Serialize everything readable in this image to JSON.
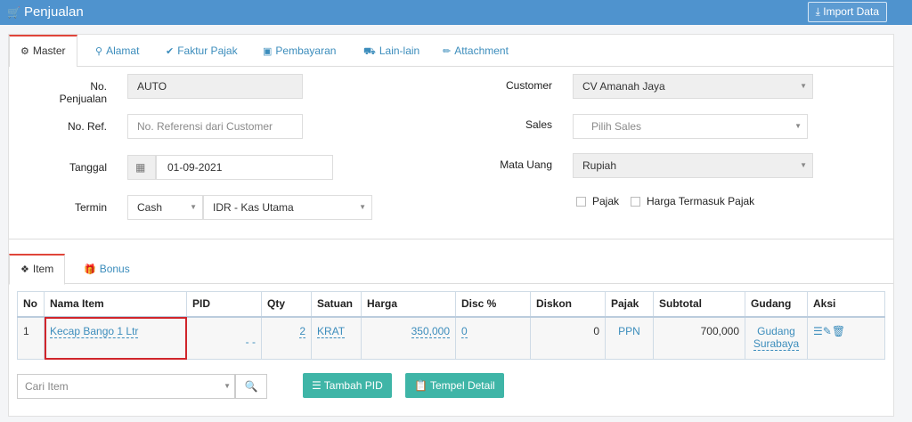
{
  "header": {
    "title": "Penjualan",
    "import_label": "Import Data"
  },
  "tabs": [
    {
      "label": "Master"
    },
    {
      "label": "Alamat"
    },
    {
      "label": "Faktur Pajak"
    },
    {
      "label": "Pembayaran"
    },
    {
      "label": "Lain-lain"
    },
    {
      "label": "Attachment"
    }
  ],
  "form": {
    "no_penjualan": {
      "label": "No. Penjualan",
      "value": "AUTO"
    },
    "no_ref": {
      "label": "No. Ref.",
      "placeholder": "No. Referensi dari Customer"
    },
    "tanggal": {
      "label": "Tanggal",
      "value": "01-09-2021"
    },
    "termin": {
      "label": "Termin",
      "value": "Cash",
      "account": "IDR - Kas Utama"
    },
    "customer": {
      "label": "Customer",
      "value": "CV Amanah Jaya"
    },
    "sales": {
      "label": "Sales",
      "placeholder": "Pilih Sales"
    },
    "mata_uang": {
      "label": "Mata Uang",
      "value": "Rupiah"
    },
    "pajak_label": "Pajak",
    "harga_termasuk_pajak_label": "Harga Termasuk Pajak"
  },
  "item_tabs": [
    {
      "label": "Item"
    },
    {
      "label": "Bonus"
    }
  ],
  "table": {
    "columns": [
      "No",
      "Nama Item",
      "PID",
      "Qty",
      "Satuan",
      "Harga",
      "Disc %",
      "Diskon",
      "Pajak",
      "Subtotal",
      "Gudang",
      "Aksi"
    ],
    "rows": [
      {
        "no": "1",
        "nama_item": "Kecap Bango 1 Ltr",
        "pid": "- -",
        "qty": "2",
        "satuan": "KRAT",
        "harga": "350,000",
        "disc": "0",
        "diskon": "0",
        "pajak": "PPN",
        "subtotal": "700,000",
        "gudang_1": "Gudang",
        "gudang_2": "Surabaya"
      }
    ]
  },
  "footer": {
    "search_placeholder": "Cari Item",
    "tambah_pid": "Tambah PID",
    "tempel_detail": "Tempel Detail"
  },
  "colors": {
    "header": "#4f93ce",
    "accent_tab": "#e0453a",
    "button_green": "#3fb5a7",
    "link": "#3c8dbc",
    "highlight": "#d0252b"
  }
}
